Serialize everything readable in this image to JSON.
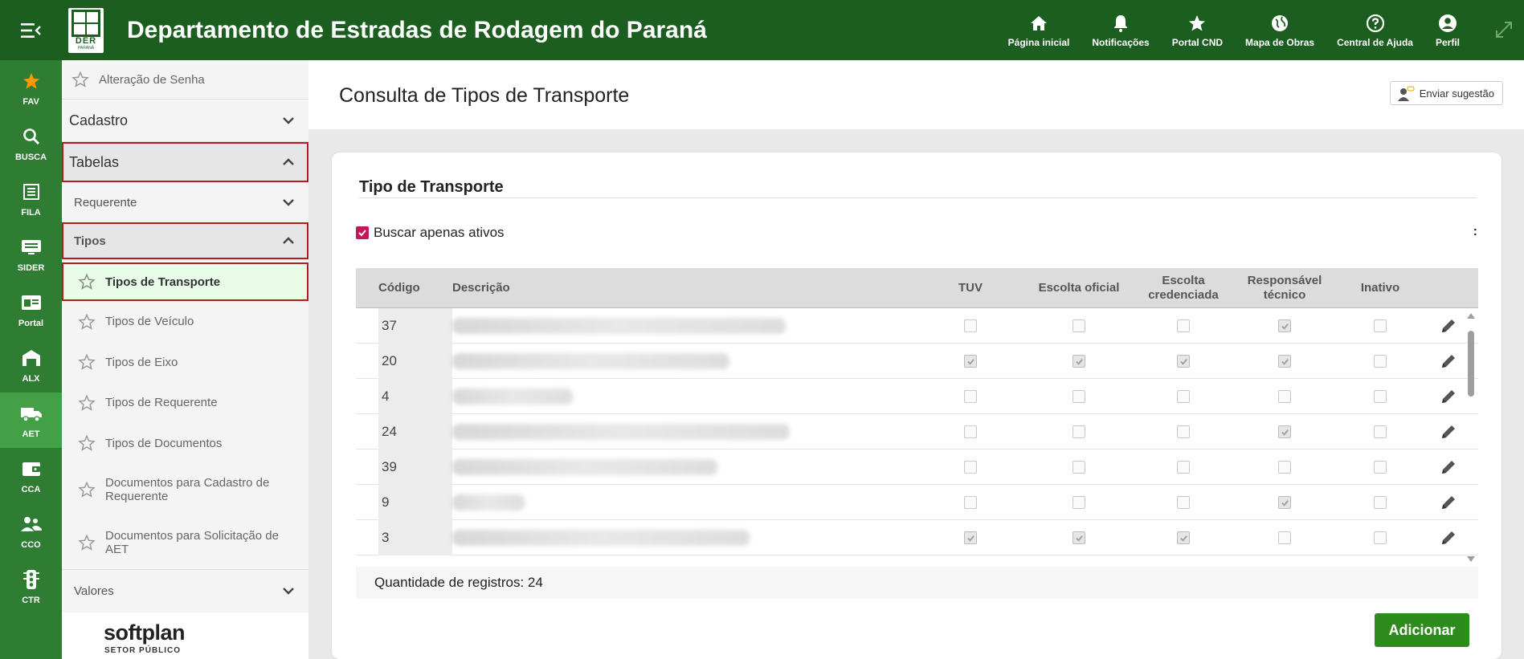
{
  "header": {
    "title": "Departamento de Estradas de Rodagem do Paraná",
    "logo_text": "DER",
    "logo_sub": "PARANÁ",
    "nav": [
      {
        "label": "Página inicial",
        "icon": "home-icon"
      },
      {
        "label": "Notificações",
        "icon": "bell-icon"
      },
      {
        "label": "Portal CND",
        "icon": "star-icon"
      },
      {
        "label": "Mapa de Obras",
        "icon": "globe-icon"
      },
      {
        "label": "Central de Ajuda",
        "icon": "help-icon"
      },
      {
        "label": "Perfil",
        "icon": "user-icon"
      }
    ]
  },
  "rail": [
    {
      "label": "FAV",
      "icon": "star-icon"
    },
    {
      "label": "BUSCA",
      "icon": "search-icon"
    },
    {
      "label": "FILA",
      "icon": "list-icon"
    },
    {
      "label": "SIDER",
      "icon": "monitor-icon"
    },
    {
      "label": "Portal",
      "icon": "portal-icon"
    },
    {
      "label": "ALX",
      "icon": "warehouse-icon"
    },
    {
      "label": "AET",
      "icon": "truck-icon",
      "active": true
    },
    {
      "label": "CCA",
      "icon": "wallet-icon"
    },
    {
      "label": "CCO",
      "icon": "people-icon"
    },
    {
      "label": "CTR",
      "icon": "traffic-light-icon"
    }
  ],
  "sidebar": {
    "top_item": "Alteração de Senha",
    "cadastro": "Cadastro",
    "tabelas": "Tabelas",
    "requerente": "Requerente",
    "tipos": "Tipos",
    "items": [
      "Tipos de Transporte",
      "Tipos de Veículo",
      "Tipos de Eixo",
      "Tipos de Requerente",
      "Tipos de Documentos",
      "Documentos para Cadastro de Requerente",
      "Documentos para Solicitação de AET"
    ],
    "valores": "Valores"
  },
  "brand": {
    "name": "softplan",
    "tagline": "SETOR PÚBLICO"
  },
  "page": {
    "title": "Consulta de Tipos de Transporte",
    "suggest_label": "Enviar sugestão"
  },
  "card": {
    "title": "Tipo de Transporte",
    "filter_label": "Buscar apenas ativos",
    "filter_checked": true,
    "kebab": ":",
    "columns": [
      "Código",
      "Descrição",
      "TUV",
      "Escolta oficial",
      "Escolta credenciada",
      "Responsável técnico",
      "Inativo"
    ],
    "rows": [
      {
        "code": "37",
        "tuv": false,
        "escolta_oficial": false,
        "escolta_credenciada": false,
        "responsavel": true,
        "inativo": false
      },
      {
        "code": "20",
        "tuv": true,
        "escolta_oficial": true,
        "escolta_credenciada": true,
        "responsavel": true,
        "inativo": false
      },
      {
        "code": "4",
        "tuv": false,
        "escolta_oficial": false,
        "escolta_credenciada": false,
        "responsavel": false,
        "inativo": false
      },
      {
        "code": "24",
        "tuv": false,
        "escolta_oficial": false,
        "escolta_credenciada": false,
        "responsavel": true,
        "inativo": false
      },
      {
        "code": "39",
        "tuv": false,
        "escolta_oficial": false,
        "escolta_credenciada": false,
        "responsavel": false,
        "inativo": false
      },
      {
        "code": "9",
        "tuv": false,
        "escolta_oficial": false,
        "escolta_credenciada": false,
        "responsavel": true,
        "inativo": false
      },
      {
        "code": "3",
        "tuv": true,
        "escolta_oficial": true,
        "escolta_credenciada": true,
        "responsavel": false,
        "inativo": false
      }
    ],
    "records_label": "Quantidade de registros: 24",
    "add_label": "Adicionar"
  },
  "colors": {
    "header": "#1b5e20",
    "rail": "#2e7d32",
    "rail_active": "#43a047",
    "accent_checkbox": "#c2185b",
    "highlight_border": "#b71c1c",
    "add_button": "#2e8b1e"
  }
}
